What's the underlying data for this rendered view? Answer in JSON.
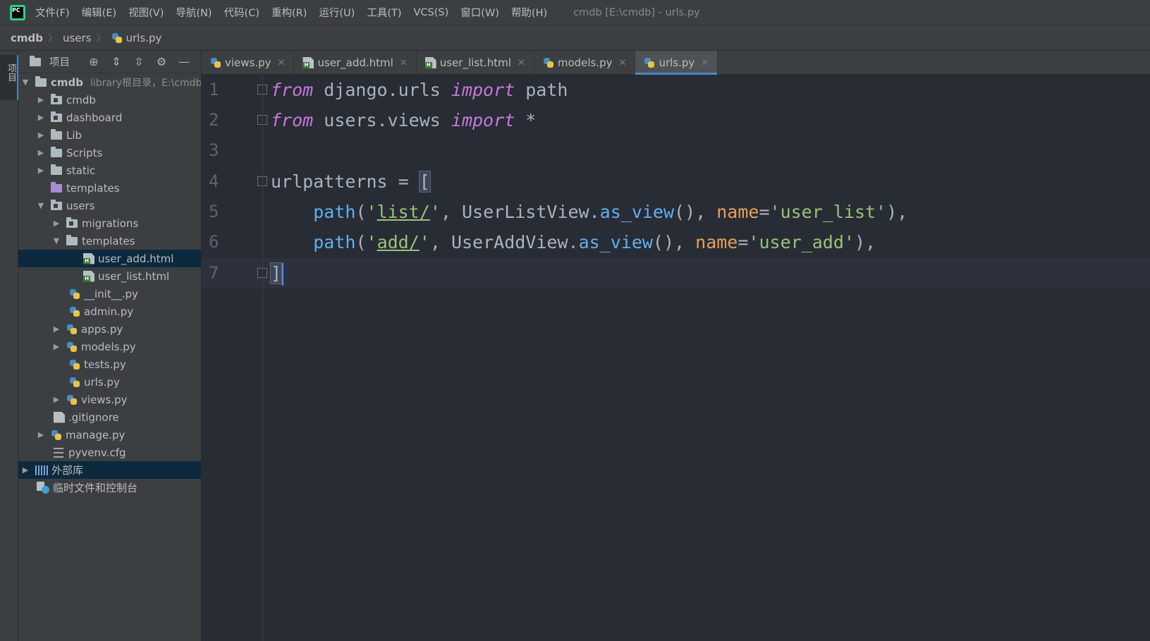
{
  "menu": {
    "items": [
      "文件(F)",
      "编辑(E)",
      "视图(V)",
      "导航(N)",
      "代码(C)",
      "重构(R)",
      "运行(U)",
      "工具(T)",
      "VCS(S)",
      "窗口(W)",
      "帮助(H)"
    ],
    "window_title": "cmdb [E:\\cmdb] - urls.py"
  },
  "breadcrumb": [
    "cmdb",
    "users",
    "urls.py"
  ],
  "toolstrip": {
    "label": "项目"
  },
  "project_panel": {
    "title": "项目",
    "tree": [
      {
        "label": "cmdb",
        "extra": "library根目录，E:\\cmdb"
      },
      {
        "label": "cmdb"
      },
      {
        "label": "dashboard"
      },
      {
        "label": "Lib"
      },
      {
        "label": "Scripts"
      },
      {
        "label": "static"
      },
      {
        "label": "templates"
      },
      {
        "label": "users"
      },
      {
        "label": "migrations"
      },
      {
        "label": "templates"
      },
      {
        "label": "user_add.html"
      },
      {
        "label": "user_list.html"
      },
      {
        "label": "__init__.py"
      },
      {
        "label": "admin.py"
      },
      {
        "label": "apps.py"
      },
      {
        "label": "models.py"
      },
      {
        "label": "tests.py"
      },
      {
        "label": "urls.py"
      },
      {
        "label": "views.py"
      },
      {
        "label": ".gitignore"
      },
      {
        "label": "manage.py"
      },
      {
        "label": "pyvenv.cfg"
      },
      {
        "label": "外部库"
      },
      {
        "label": "临时文件和控制台"
      }
    ]
  },
  "tabs": [
    {
      "label": "views.py"
    },
    {
      "label": "user_add.html"
    },
    {
      "label": "user_list.html"
    },
    {
      "label": "models.py"
    },
    {
      "label": "urls.py",
      "active": true
    }
  ],
  "editor": {
    "line_numbers": [
      "1",
      "2",
      "3",
      "4",
      "5",
      "6",
      "7"
    ],
    "code": {
      "l1": {
        "kw1": "from",
        "mod": " django.urls ",
        "kw2": "import",
        "name": " path"
      },
      "l2": {
        "kw1": "from",
        "mod": " users.views ",
        "kw2": "import",
        "name": " *"
      },
      "l4": {
        "var": "urlpatterns = ",
        "open": "["
      },
      "l5": {
        "fn": "path",
        "p1": "(",
        "q1": "'",
        "route": "list/",
        "q2": "'",
        "sep1": ", UserListView.",
        "method": "as_view",
        "sep2": "(), ",
        "param": "name",
        "eq": "=",
        "value": "'user_list'",
        "end": "),"
      },
      "l6": {
        "fn": "path",
        "p1": "(",
        "q1": "'",
        "route": "add/",
        "q2": "'",
        "sep1": ", UserAddView.",
        "method": "as_view",
        "sep2": "(), ",
        "param": "name",
        "eq": "=",
        "value": "'user_add'",
        "end": "),"
      },
      "l7": {
        "close": "]"
      }
    }
  }
}
